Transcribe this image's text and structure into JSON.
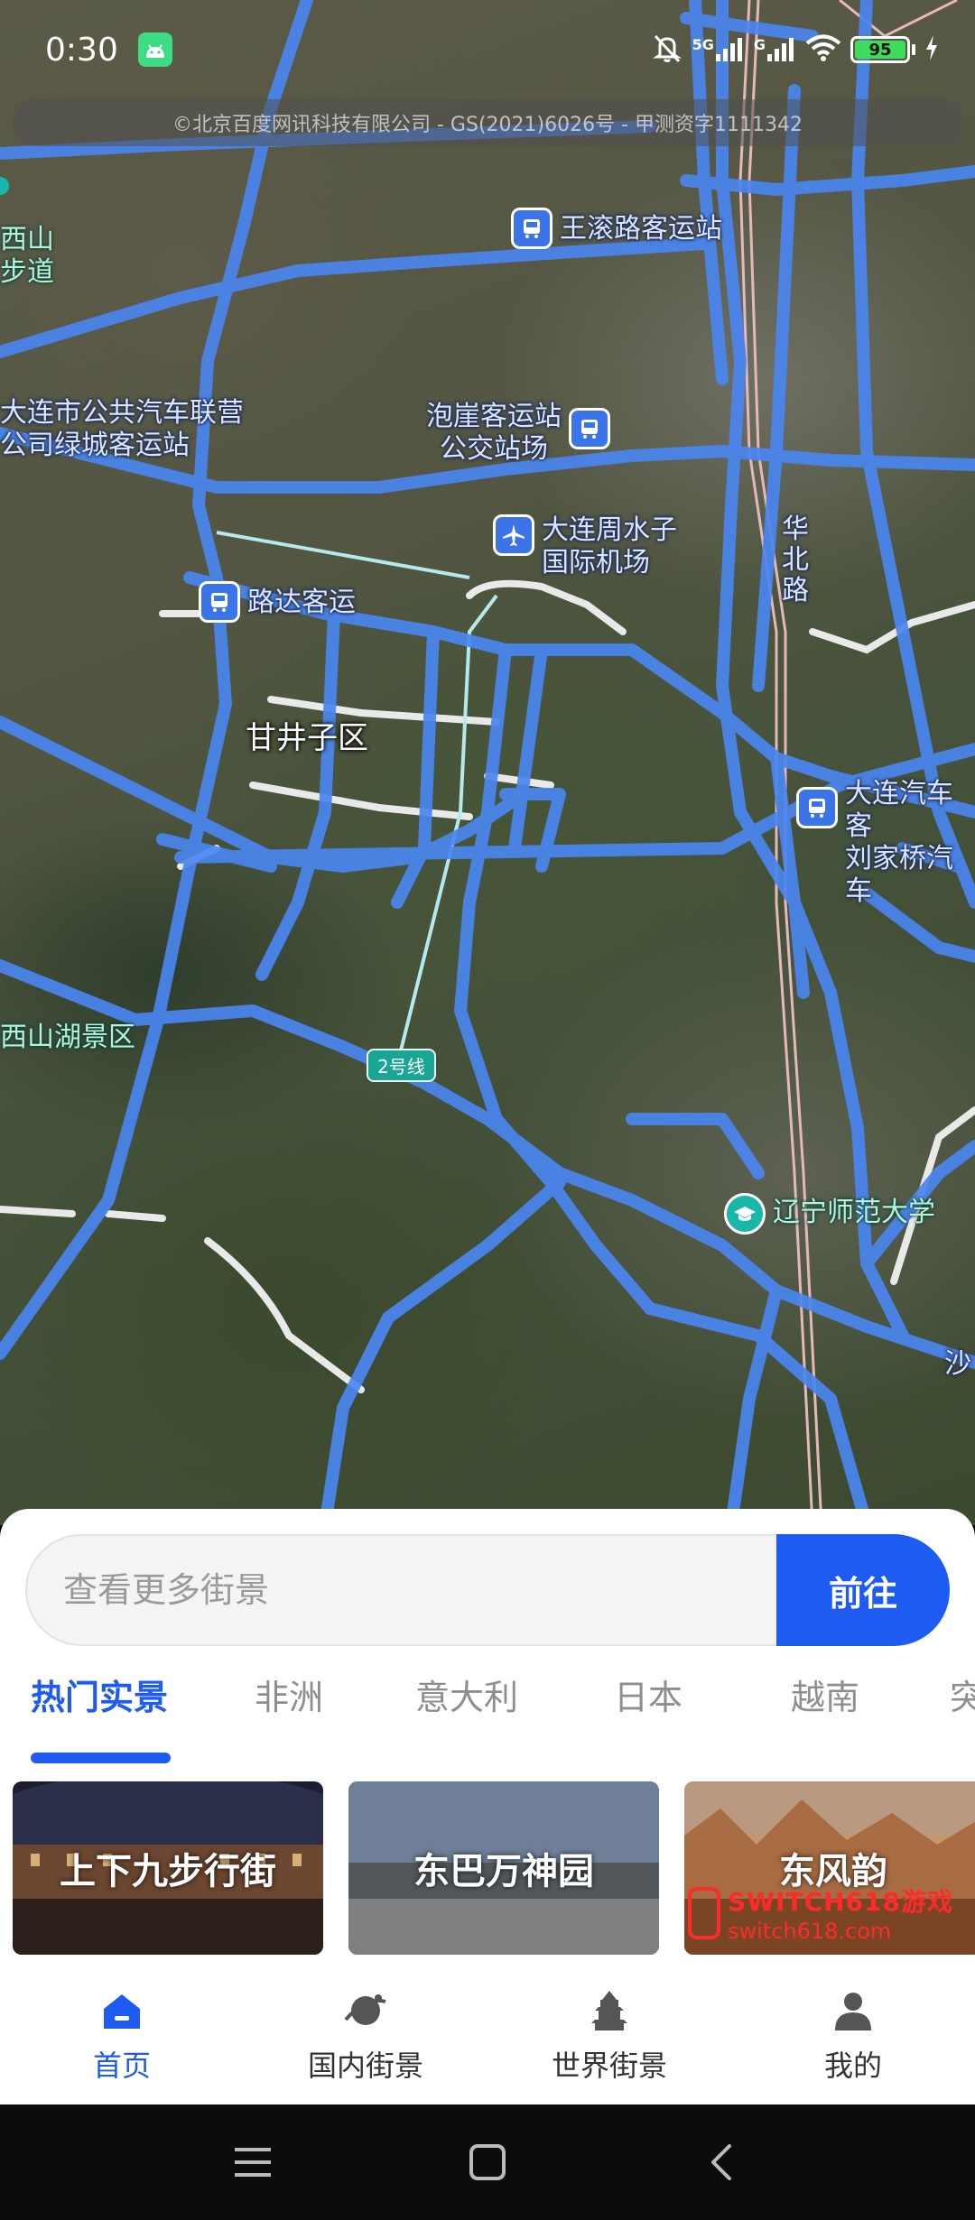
{
  "status_bar": {
    "time": "0:30",
    "battery_level": "95",
    "network_label_1": "5G",
    "network_label_2": "G"
  },
  "map": {
    "copyright": "©北京百度网讯科技有限公司 - GS(2021)6026号 - 甲测资字1111342",
    "pois": [
      {
        "label": "王滚路客运站",
        "type": "bus"
      },
      {
        "label": "大连市公共汽车联营\n公司绿城客运站",
        "type": "text"
      },
      {
        "label": "泡崖客运站\n公交站场",
        "type": "bus"
      },
      {
        "label": "大连周水子\n国际机场",
        "type": "airport"
      },
      {
        "label": "华\n北\n路",
        "type": "road"
      },
      {
        "label": "路达客运",
        "type": "bus"
      },
      {
        "label": "甘井子区",
        "type": "district"
      },
      {
        "label": "大连汽车客\n刘家桥汽车",
        "type": "bus"
      },
      {
        "label": "西山湖景区",
        "type": "scenic"
      },
      {
        "label": "2号线",
        "type": "metro"
      },
      {
        "label": "辽宁师范大学",
        "type": "school"
      },
      {
        "label": "西山\n步道",
        "type": "scenic"
      },
      {
        "label": "沙",
        "type": "text"
      }
    ]
  },
  "search": {
    "placeholder": "查看更多街景",
    "go_label": "前往"
  },
  "tabs": [
    {
      "label": "热门实景",
      "active": true
    },
    {
      "label": "非洲",
      "active": false
    },
    {
      "label": "意大利",
      "active": false
    },
    {
      "label": "日本",
      "active": false
    },
    {
      "label": "越南",
      "active": false
    },
    {
      "label": "突",
      "active": false
    }
  ],
  "cards": [
    {
      "title": "上下九步行街"
    },
    {
      "title": "东巴万神园"
    },
    {
      "title": "东风韵"
    }
  ],
  "watermark": {
    "line1": "SWITCH618游戏",
    "line2": "switch618.com"
  },
  "bottom_nav": [
    {
      "label": "首页",
      "icon": "home-icon",
      "active": true
    },
    {
      "label": "国内街景",
      "icon": "planet-icon",
      "active": false
    },
    {
      "label": "世界街景",
      "icon": "pagoda-icon",
      "active": false
    },
    {
      "label": "我的",
      "icon": "person-icon",
      "active": false
    }
  ],
  "colors": {
    "accent": "#1e5bf0",
    "road": "#4a86f0",
    "poi_blue": "#3b73e8"
  }
}
